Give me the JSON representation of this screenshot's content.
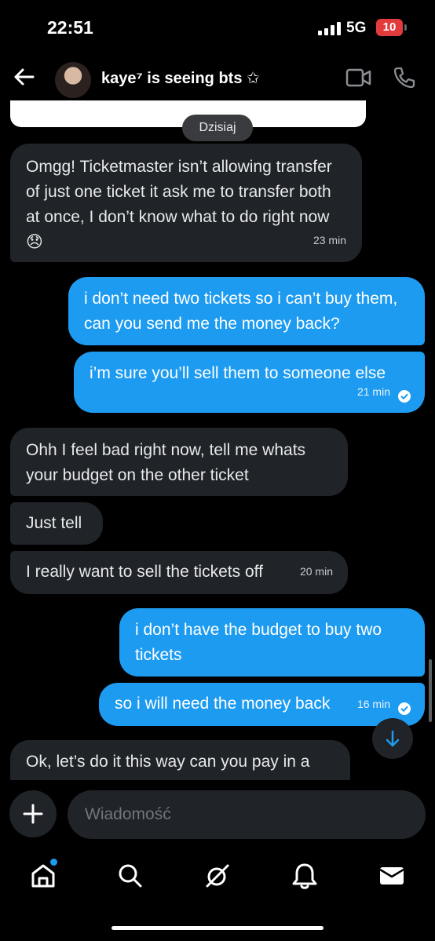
{
  "status": {
    "time": "22:51",
    "network": "5G",
    "battery": "10"
  },
  "header": {
    "title": "kaye⁷ is seeing bts ✩"
  },
  "conversation": {
    "day_label": "Dzisiaj",
    "messages": [
      {
        "side": "in",
        "text": "Omgg! Ticketmaster isn’t allowing transfer of just one ticket it ask me to transfer both at once, I don’t know what to do right now 😞",
        "time": "23 min"
      },
      {
        "side": "out",
        "text": "i don’t need two tickets so i can’t buy them, can you send me the money back?"
      },
      {
        "side": "out",
        "text": "i’m sure you’ll sell them to someone else",
        "time": "21 min"
      },
      {
        "side": "in",
        "text": "Ohh I feel bad right now, tell me whats your budget on the other ticket"
      },
      {
        "side": "in",
        "text": "Just tell"
      },
      {
        "side": "in",
        "text": "I really want to sell the tickets off",
        "time": "20 min"
      },
      {
        "side": "out",
        "text": "i don’t have the budget to buy two tickets"
      },
      {
        "side": "out",
        "text": "so i will need the money back",
        "time": "16 min"
      },
      {
        "side": "in",
        "text": "Ok, let’s do it this way can you pay in a"
      }
    ]
  },
  "composer": {
    "placeholder": "Wiadomość"
  },
  "tabbar": {
    "tabs": [
      "home-icon",
      "search-icon",
      "grok-icon",
      "notifications-icon",
      "messages-icon"
    ]
  },
  "colors": {
    "accent": "#1d9bf0",
    "incoming_bubble": "#202327",
    "background": "#000000",
    "battery_low": "#e33b3b"
  }
}
